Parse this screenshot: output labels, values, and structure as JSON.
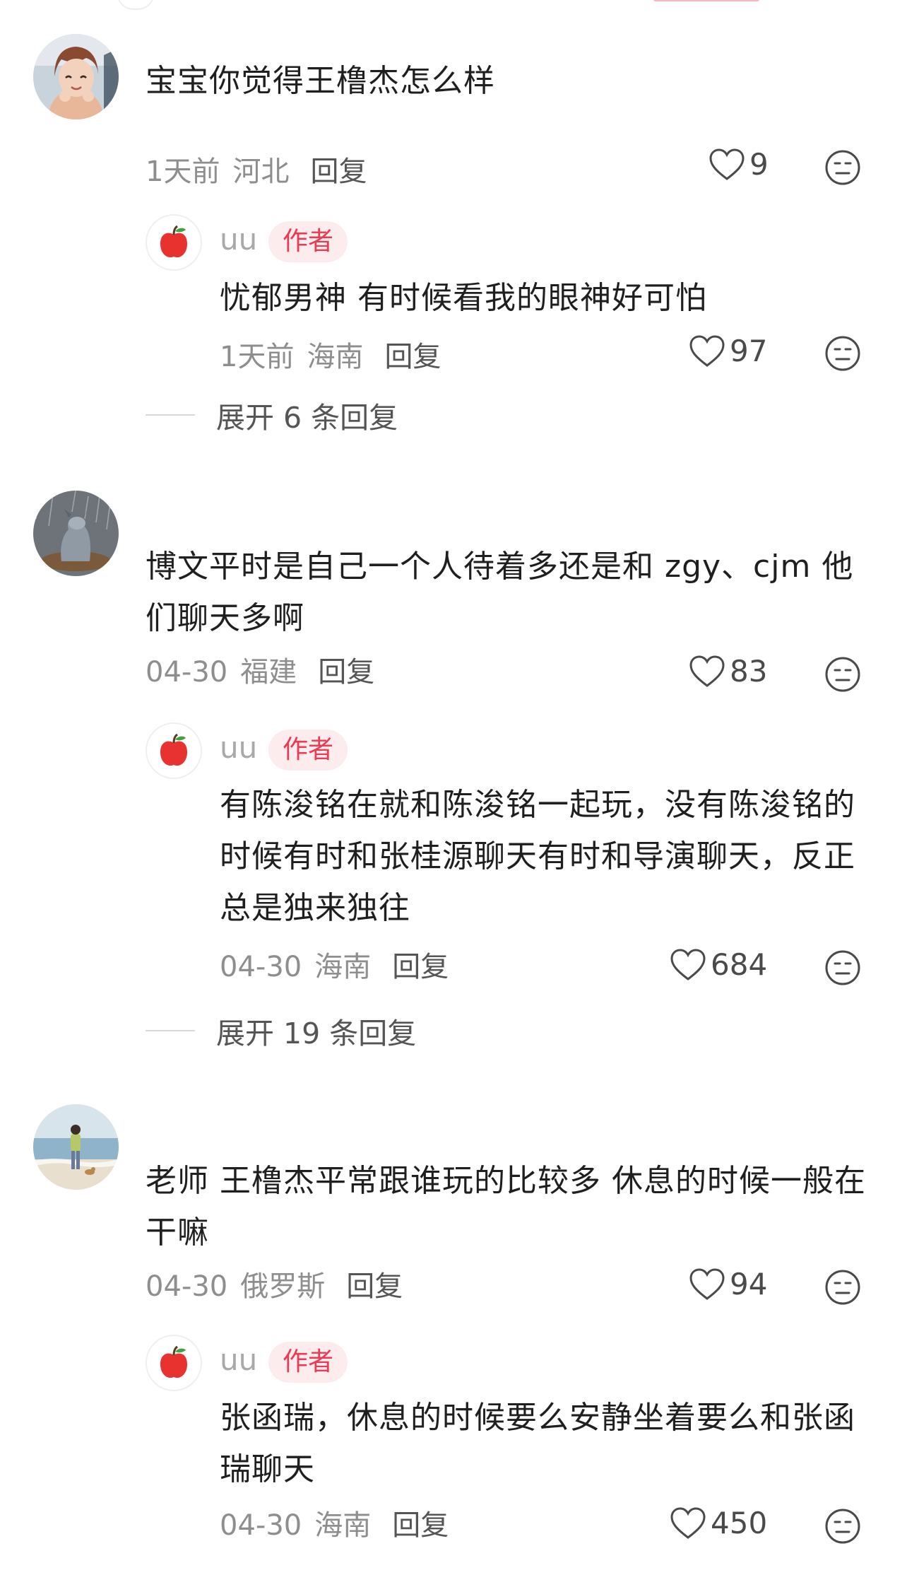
{
  "comments": [
    {
      "text": "宝宝你觉得王橹杰怎么样",
      "time": "1天前",
      "location": "河北",
      "reply_label": "回复",
      "likes": "9",
      "avatar": "anime-girl-avatar",
      "author_reply": {
        "name": "uu",
        "badge": "作者",
        "text": "忧郁男神 有时候看我的眼神好可怕",
        "time": "1天前",
        "location": "海南",
        "reply_label": "回复",
        "likes": "97"
      },
      "expand_label": "展开 6 条回复"
    },
    {
      "text": "博文平时是自己一个人待着多还是和 zgy、cjm 他们聊天多啊",
      "time": "04-30",
      "location": "福建",
      "reply_label": "回复",
      "likes": "83",
      "avatar": "donkey-in-rain-avatar",
      "author_reply": {
        "name": "uu",
        "badge": "作者",
        "text": "有陈浚铭在就和陈浚铭一起玩，没有陈浚铭的时候有时和张桂源聊天有时和导演聊天，反正总是独来独往",
        "time": "04-30",
        "location": "海南",
        "reply_label": "回复",
        "likes": "684"
      },
      "expand_label": "展开 19 条回复"
    },
    {
      "text": "老师 王橹杰平常跟谁玩的比较多 休息的时候一般在干嘛",
      "time": "04-30",
      "location": "俄罗斯",
      "reply_label": "回复",
      "likes": "94",
      "avatar": "beach-with-dog-avatar",
      "author_reply": {
        "name": "uu",
        "badge": "作者",
        "text": "张函瑞，休息的时候要么安静坐着要么和张函瑞聊天",
        "time": "04-30",
        "location": "海南",
        "reply_label": "回复",
        "likes": "450"
      }
    }
  ],
  "colors": {
    "badge_bg": "#fdecee",
    "badge_text": "#ec3a52",
    "meta_text": "#8e8e8e",
    "apple_red": "#e8322f"
  },
  "icons": {
    "like": "heart-outline-icon",
    "dislike": "sad-face-icon",
    "author_avatar": "apple-icon"
  }
}
